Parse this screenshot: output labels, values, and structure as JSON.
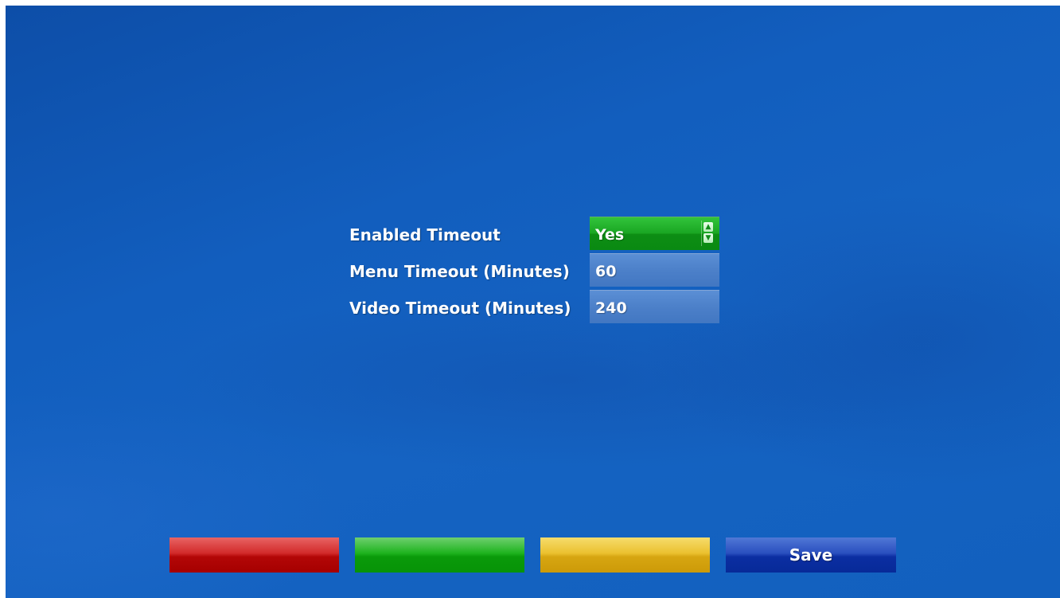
{
  "settings": {
    "rows": [
      {
        "label": "Enabled Timeout",
        "value": "Yes"
      },
      {
        "label": "Menu Timeout (Minutes)",
        "value": "60"
      },
      {
        "label": "Video Timeout (Minutes)",
        "value": "240"
      }
    ]
  },
  "footer": {
    "red_label": "",
    "green_label": "",
    "yellow_label": "",
    "blue_label": "Save"
  },
  "icons": {
    "spinner_up": "chevron-up-icon",
    "spinner_down": "chevron-down-icon"
  },
  "colors": {
    "background": "#125ebe",
    "select_active": "#1aa623",
    "field": "#4c80c9",
    "red": "#b30707",
    "green": "#0a9a0a",
    "yellow": "#d7a611",
    "blue": "#0b2ea2"
  }
}
